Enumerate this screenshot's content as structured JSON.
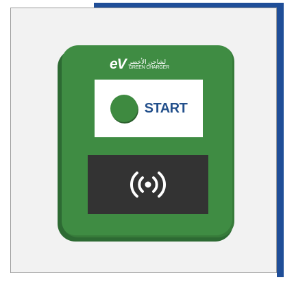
{
  "brand": {
    "logo": "eV",
    "arabic": "لشاحن الأخضر",
    "english": "GREEN CHARGER"
  },
  "start": {
    "label": "START"
  },
  "icons": {
    "nfc": "nfc-contactless-icon"
  },
  "colors": {
    "accent_frame": "#1f4e98",
    "device_green": "#3f8c43",
    "start_text": "#23508c",
    "reader_panel": "#333333"
  }
}
